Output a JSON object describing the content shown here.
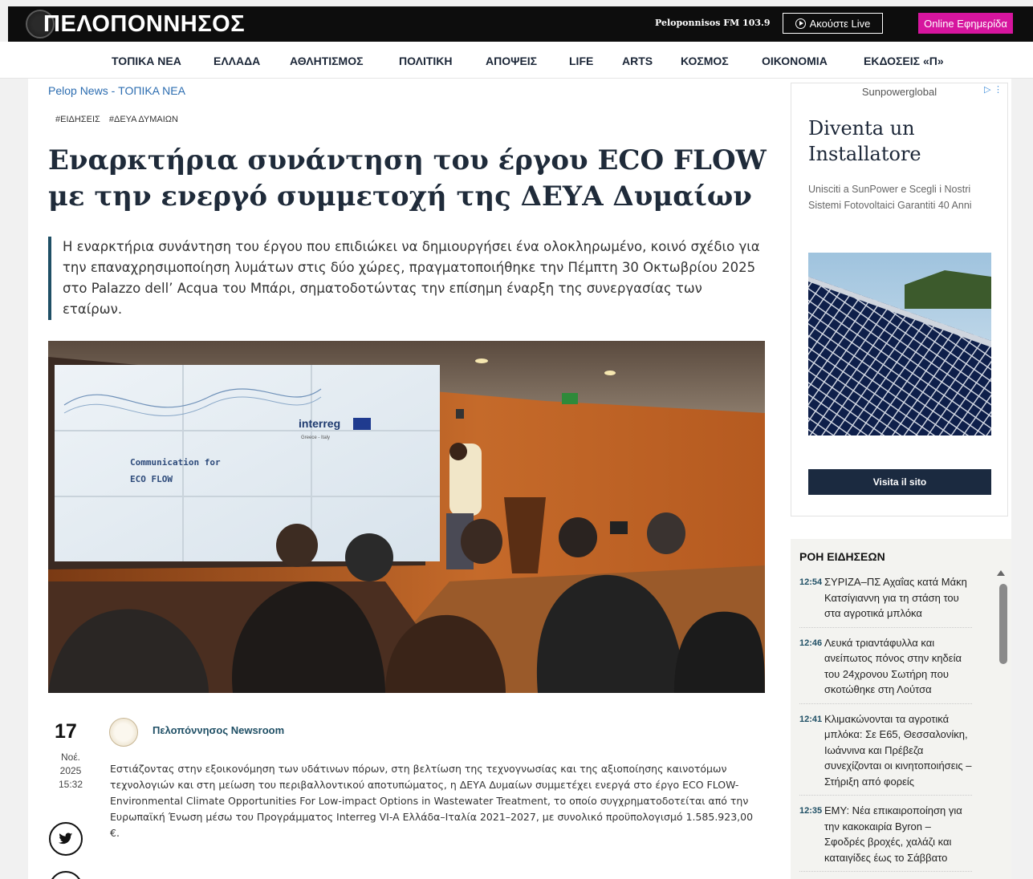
{
  "header": {
    "logo": "ΠΕΛΟΠΟΝΝΗΣΟΣ",
    "radio": "Peloponnisos FM 103.9",
    "live_button": "Ακούστε Live",
    "paper_button": "Online Εφημερίδα"
  },
  "nav": [
    "ΤΟΠΙΚΑ ΝΕΑ",
    "ΕΛΛΑΔΑ",
    "ΑΘΛΗΤΙΣΜΟΣ",
    "ΠΟΛΙΤΙΚΗ",
    "ΑΠΟΨΕΙΣ",
    "LIFE",
    "ARTS",
    "ΚΟΣΜΟΣ",
    "ΟΙΚΟΝΟΜΙΑ",
    "ΕΚΔΟΣΕΙΣ «Π»"
  ],
  "article": {
    "breadcrumb": "Pelop News - ΤΟΠΙΚΑ ΝΕΑ",
    "tags": [
      "#ΕΙΔΗΣΕΙΣ",
      "#ΔΕΥΑ ΔΥΜΑΙΩΝ"
    ],
    "title": "Εναρκτήρια συνάντηση του έργου ECO FLOW με την ενεργό συμμετοχή της ΔΕΥΑ Δυμαίων",
    "lead": "Η εναρκτήρια συνάντηση του έργου που επιδιώκει να δημιουργήσει ένα ολοκληρωμένο, κοινό σχέδιο για την επαναχρησιμοποίηση λυμάτων στις δύο χώρες, πραγματοποιήθηκε την Πέμπτη 30 Οκτωβρίου 2025 στο Palazzo dell’ Acqua του Μπάρι, σηματοδοτώντας την επίσημη έναρξη της συνεργασίας των εταίρων.",
    "photo": {
      "screen_line1": "Communication for",
      "screen_line2": "ECO FLOW",
      "screen_logo": "interreg",
      "screen_logo_sub": "Greece - Italy"
    },
    "date": {
      "day": "17",
      "month": "Νοέ.",
      "year": "2025",
      "time": "15:32"
    },
    "author": "Πελοπόννησος Newsroom",
    "body": "Εστιάζοντας στην εξοικονόμηση των υδάτινων πόρων, στη βελτίωση της τεχνογνωσίας και της αξιοποίησης καινοτόμων τεχνολογιών και στη μείωση του περιβαλλοντικού αποτυπώματος, η ΔΕΥΑ Δυμαίων συμμετέχει ενεργά στο έργο ECO FLOW- Environmental Climate Opportunities For Low-impact Options in Wastewater Treatment, το οποίο συγχρηματοδοτείται από την Ευρωπαϊκή Ένωση μέσω του Προγράμματος Interreg VI-A Ελλάδα–Ιταλία 2021–2027, με συνολικό προϋπολογισμό 1.585.923,00 €.",
    "share_icons": [
      "twitter-icon",
      "share-icon"
    ]
  },
  "ad": {
    "brand": "Sunpowerglobal",
    "title": "Diventa un Installatore",
    "text": "Unisciti a SunPower e Scegli i Nostri Sistemi Fotovoltaici Garantiti 40 Anni",
    "button": "Visita il sito"
  },
  "feed": {
    "title": "ΡΟΗ ΕΙΔΗΣΕΩΝ",
    "items": [
      {
        "time": "12:54",
        "headline": "ΣΥΡΙΖΑ–ΠΣ Αχαΐας κατά Μάκη Κατσίγιαννη για τη στάση του στα αγροτικά μπλόκα"
      },
      {
        "time": "12:46",
        "headline": "Λευκά τριαντάφυλλα και ανείπωτος πόνος στην κηδεία του 24χρονου Σωτήρη που σκοτώθηκε στη Λούτσα"
      },
      {
        "time": "12:41",
        "headline": "Κλιμακώνονται τα αγροτικά μπλόκα: Σε Ε65, Θεσσαλονίκη, Ιωάννινα και Πρέβεζα συνεχίζονται οι κινητοποιήσεις – Στήριξη από φορείς"
      },
      {
        "time": "12:35",
        "headline": "ΕΜΥ: Νέα επικαιροποίηση για την κακοκαιρία Byron – Σφοδρές βροχές, χαλάζι και καταιγίδες έως το Σάββατο"
      }
    ]
  }
}
